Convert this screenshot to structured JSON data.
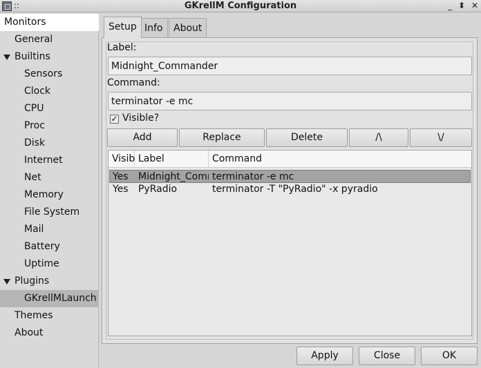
{
  "window": {
    "title": "GKrellM Configuration",
    "dots": "::",
    "controls": [
      "_",
      "⬍",
      "✕"
    ]
  },
  "sidebar": {
    "items": [
      {
        "label": "Monitors"
      },
      {
        "label": "General"
      },
      {
        "label": "Builtins"
      },
      {
        "label": "Sensors"
      },
      {
        "label": "Clock"
      },
      {
        "label": "CPU"
      },
      {
        "label": "Proc"
      },
      {
        "label": "Disk"
      },
      {
        "label": "Internet"
      },
      {
        "label": "Net"
      },
      {
        "label": "Memory"
      },
      {
        "label": "File System"
      },
      {
        "label": "Mail"
      },
      {
        "label": "Battery"
      },
      {
        "label": "Uptime"
      },
      {
        "label": "Plugins"
      },
      {
        "label": "GKrellMLaunch"
      },
      {
        "label": "Themes"
      },
      {
        "label": "About"
      }
    ]
  },
  "tabs": [
    {
      "label": "Setup"
    },
    {
      "label": "Info"
    },
    {
      "label": "About"
    }
  ],
  "form": {
    "label_caption": "Label:",
    "label_value": "Midnight_Commander",
    "command_caption": "Command:",
    "command_value": "terminator -e mc",
    "visible_label": "Visible?",
    "visible_checked": true
  },
  "actions": {
    "add": "Add",
    "replace": "Replace",
    "delete": "Delete",
    "up": "/\\",
    "down": "\\/"
  },
  "table": {
    "columns": [
      "Visib",
      "Label",
      "Command"
    ],
    "rows": [
      {
        "visible": "Yes",
        "label": "Midnight_Commander",
        "command": "terminator -e mc"
      },
      {
        "visible": "Yes",
        "label": "PyRadio",
        "command": "terminator -T \"PyRadio\" -x pyradio"
      }
    ]
  },
  "footer": {
    "apply": "Apply",
    "close": "Close",
    "ok": "OK"
  }
}
